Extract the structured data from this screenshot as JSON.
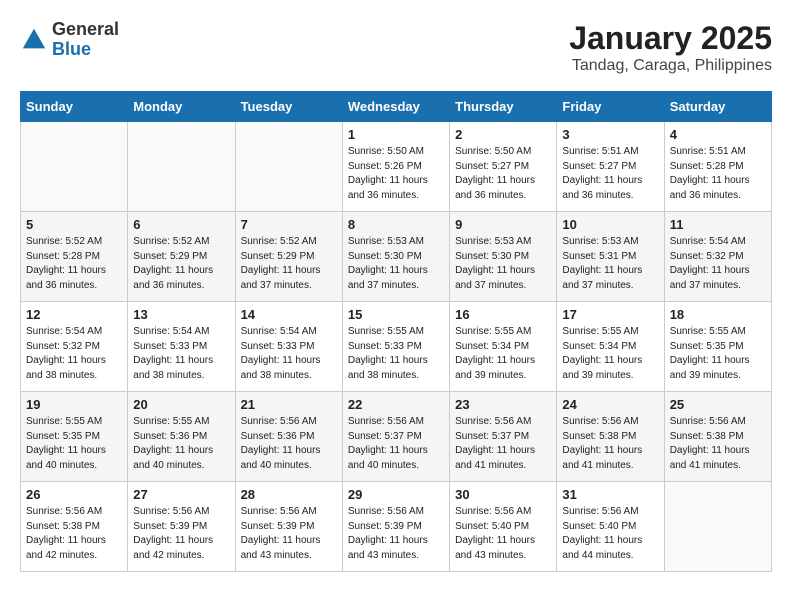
{
  "header": {
    "logo_general": "General",
    "logo_blue": "Blue",
    "month": "January 2025",
    "location": "Tandag, Caraga, Philippines"
  },
  "days_of_week": [
    "Sunday",
    "Monday",
    "Tuesday",
    "Wednesday",
    "Thursday",
    "Friday",
    "Saturday"
  ],
  "weeks": [
    [
      {
        "day": "",
        "info": ""
      },
      {
        "day": "",
        "info": ""
      },
      {
        "day": "",
        "info": ""
      },
      {
        "day": "1",
        "info": "Sunrise: 5:50 AM\nSunset: 5:26 PM\nDaylight: 11 hours and 36 minutes."
      },
      {
        "day": "2",
        "info": "Sunrise: 5:50 AM\nSunset: 5:27 PM\nDaylight: 11 hours and 36 minutes."
      },
      {
        "day": "3",
        "info": "Sunrise: 5:51 AM\nSunset: 5:27 PM\nDaylight: 11 hours and 36 minutes."
      },
      {
        "day": "4",
        "info": "Sunrise: 5:51 AM\nSunset: 5:28 PM\nDaylight: 11 hours and 36 minutes."
      }
    ],
    [
      {
        "day": "5",
        "info": "Sunrise: 5:52 AM\nSunset: 5:28 PM\nDaylight: 11 hours and 36 minutes."
      },
      {
        "day": "6",
        "info": "Sunrise: 5:52 AM\nSunset: 5:29 PM\nDaylight: 11 hours and 36 minutes."
      },
      {
        "day": "7",
        "info": "Sunrise: 5:52 AM\nSunset: 5:29 PM\nDaylight: 11 hours and 37 minutes."
      },
      {
        "day": "8",
        "info": "Sunrise: 5:53 AM\nSunset: 5:30 PM\nDaylight: 11 hours and 37 minutes."
      },
      {
        "day": "9",
        "info": "Sunrise: 5:53 AM\nSunset: 5:30 PM\nDaylight: 11 hours and 37 minutes."
      },
      {
        "day": "10",
        "info": "Sunrise: 5:53 AM\nSunset: 5:31 PM\nDaylight: 11 hours and 37 minutes."
      },
      {
        "day": "11",
        "info": "Sunrise: 5:54 AM\nSunset: 5:32 PM\nDaylight: 11 hours and 37 minutes."
      }
    ],
    [
      {
        "day": "12",
        "info": "Sunrise: 5:54 AM\nSunset: 5:32 PM\nDaylight: 11 hours and 38 minutes."
      },
      {
        "day": "13",
        "info": "Sunrise: 5:54 AM\nSunset: 5:33 PM\nDaylight: 11 hours and 38 minutes."
      },
      {
        "day": "14",
        "info": "Sunrise: 5:54 AM\nSunset: 5:33 PM\nDaylight: 11 hours and 38 minutes."
      },
      {
        "day": "15",
        "info": "Sunrise: 5:55 AM\nSunset: 5:33 PM\nDaylight: 11 hours and 38 minutes."
      },
      {
        "day": "16",
        "info": "Sunrise: 5:55 AM\nSunset: 5:34 PM\nDaylight: 11 hours and 39 minutes."
      },
      {
        "day": "17",
        "info": "Sunrise: 5:55 AM\nSunset: 5:34 PM\nDaylight: 11 hours and 39 minutes."
      },
      {
        "day": "18",
        "info": "Sunrise: 5:55 AM\nSunset: 5:35 PM\nDaylight: 11 hours and 39 minutes."
      }
    ],
    [
      {
        "day": "19",
        "info": "Sunrise: 5:55 AM\nSunset: 5:35 PM\nDaylight: 11 hours and 40 minutes."
      },
      {
        "day": "20",
        "info": "Sunrise: 5:55 AM\nSunset: 5:36 PM\nDaylight: 11 hours and 40 minutes."
      },
      {
        "day": "21",
        "info": "Sunrise: 5:56 AM\nSunset: 5:36 PM\nDaylight: 11 hours and 40 minutes."
      },
      {
        "day": "22",
        "info": "Sunrise: 5:56 AM\nSunset: 5:37 PM\nDaylight: 11 hours and 40 minutes."
      },
      {
        "day": "23",
        "info": "Sunrise: 5:56 AM\nSunset: 5:37 PM\nDaylight: 11 hours and 41 minutes."
      },
      {
        "day": "24",
        "info": "Sunrise: 5:56 AM\nSunset: 5:38 PM\nDaylight: 11 hours and 41 minutes."
      },
      {
        "day": "25",
        "info": "Sunrise: 5:56 AM\nSunset: 5:38 PM\nDaylight: 11 hours and 41 minutes."
      }
    ],
    [
      {
        "day": "26",
        "info": "Sunrise: 5:56 AM\nSunset: 5:38 PM\nDaylight: 11 hours and 42 minutes."
      },
      {
        "day": "27",
        "info": "Sunrise: 5:56 AM\nSunset: 5:39 PM\nDaylight: 11 hours and 42 minutes."
      },
      {
        "day": "28",
        "info": "Sunrise: 5:56 AM\nSunset: 5:39 PM\nDaylight: 11 hours and 43 minutes."
      },
      {
        "day": "29",
        "info": "Sunrise: 5:56 AM\nSunset: 5:39 PM\nDaylight: 11 hours and 43 minutes."
      },
      {
        "day": "30",
        "info": "Sunrise: 5:56 AM\nSunset: 5:40 PM\nDaylight: 11 hours and 43 minutes."
      },
      {
        "day": "31",
        "info": "Sunrise: 5:56 AM\nSunset: 5:40 PM\nDaylight: 11 hours and 44 minutes."
      },
      {
        "day": "",
        "info": ""
      }
    ]
  ]
}
